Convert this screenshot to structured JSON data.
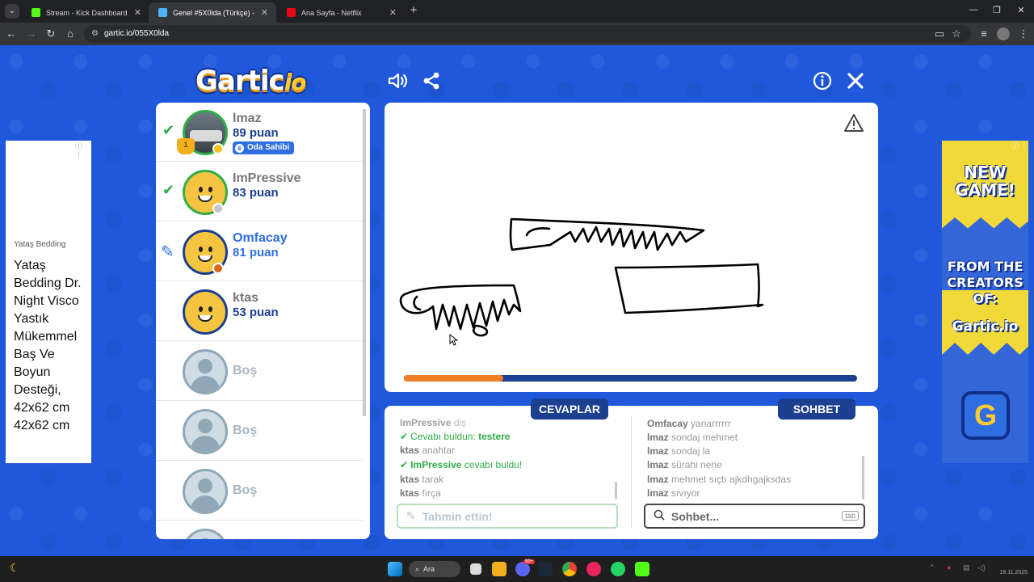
{
  "browser": {
    "tabs": [
      {
        "title": "Stream - Kick Dashboard",
        "color": "#53fc18",
        "active": false
      },
      {
        "title": "Genel #5X0lda (Türkçe) - Gartic",
        "color": "#4db3ff",
        "active": true
      },
      {
        "title": "Ana Sayfa - Netflix",
        "color": "#e50914",
        "active": false
      }
    ],
    "url": "gartic.io/055X0lda"
  },
  "game": {
    "logo_main": "Gartic",
    "logo_suffix": "io",
    "owner_badge": "Oda Sahibi",
    "trophy_rank": "1",
    "players": [
      {
        "name": "lmaz",
        "points": "89 puan",
        "status": "guessed",
        "owner": true,
        "dot": "#f2c21e",
        "avatar": "photo"
      },
      {
        "name": "ImPressive",
        "points": "83 puan",
        "status": "guessed",
        "owner": false,
        "dot": "#c7c7c7",
        "avatar": "face"
      },
      {
        "name": "Omfacay",
        "points": "81 puan",
        "status": "drawing",
        "owner": false,
        "dot": "#d8661a",
        "avatar": "face"
      },
      {
        "name": "ktas",
        "points": "53 puan",
        "status": "none",
        "owner": false,
        "dot": "",
        "avatar": "face"
      },
      {
        "name": "Boş",
        "points": "",
        "status": "empty"
      },
      {
        "name": "Boş",
        "points": "",
        "status": "empty"
      },
      {
        "name": "Boş",
        "points": "",
        "status": "empty"
      }
    ],
    "timer_progress": 0.22,
    "answers_header": "CEVAPLAR",
    "chat_header": "SOHBET",
    "answers": [
      {
        "user": "ImPressive",
        "text": "diş",
        "type": "normal"
      },
      {
        "user": "",
        "text": "Cevabı buldun: ",
        "highlight": "testere",
        "type": "found-self"
      },
      {
        "user": "ktas",
        "text": "anahtar",
        "type": "normal"
      },
      {
        "user": "ImPressive",
        "text": "cevabı buldu!",
        "type": "found-other"
      },
      {
        "user": "ktas",
        "text": "tarak",
        "type": "normal"
      },
      {
        "user": "ktas",
        "text": "fırça",
        "type": "normal"
      }
    ],
    "chat": [
      {
        "user": "Omfacay",
        "text": "yanarrrrrr"
      },
      {
        "user": "lmaz",
        "text": "sondaj mehmet"
      },
      {
        "user": "lmaz",
        "text": "sondaj la"
      },
      {
        "user": "lmaz",
        "text": "sürahi nene"
      },
      {
        "user": "lmaz",
        "text": "mehmet sıçtı ajkdhgajksdas"
      },
      {
        "user": "lmaz",
        "text": "sıvıyor"
      }
    ],
    "guess_placeholder": "Tahmin ettin!",
    "chat_placeholder": "Sohbet...",
    "tab_key": "tab"
  },
  "ads": {
    "left_small": "Yataş Bedding",
    "left_big": "Yataş Bedding Dr. Night Visco Yastık Mükemmel Baş Ve Boyun Desteği, 42x62 cm 42x62 cm",
    "right_line1": "NEW GAME!",
    "right_line2": "FROM THE CREATORS OF:",
    "right_brand": "Gartic.io",
    "right_logo": "G"
  },
  "taskbar": {
    "search_label": "Ara",
    "notification_count": "99+",
    "date": "18.11.2025"
  },
  "colors": {
    "game_blue": "#1d55d8",
    "navy": "#1c3f8f",
    "accent_orange": "#f07e26",
    "success_green": "#2fae47",
    "drawer_blue": "#2f6ee0"
  }
}
